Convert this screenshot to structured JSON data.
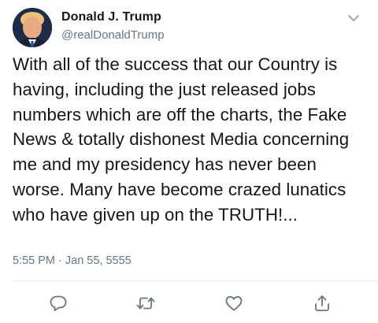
{
  "tweet": {
    "author": {
      "display_name": "Donald J. Trump",
      "handle": "@realDonaldTrump",
      "avatar_icon": "profile-avatar"
    },
    "text": "With all of the success that our Country is having, including the just released jobs numbers which are off the charts, the Fake News & totally dishonest Media concerning me and my presidency has never been worse. Many have become crazed lunatics who have given up on the TRUTH!...",
    "timestamp": "5:55 PM · Jan 55, 5555",
    "menu_icon": "chevron-down-icon"
  },
  "actions": [
    {
      "name": "reply",
      "icon": "reply-icon"
    },
    {
      "name": "retweet",
      "icon": "retweet-icon"
    },
    {
      "name": "like",
      "icon": "heart-icon"
    },
    {
      "name": "share",
      "icon": "share-icon"
    }
  ],
  "colors": {
    "text": "#14171a",
    "secondary": "#657786",
    "icon": "#657786",
    "divider": "#e1e8ed"
  }
}
